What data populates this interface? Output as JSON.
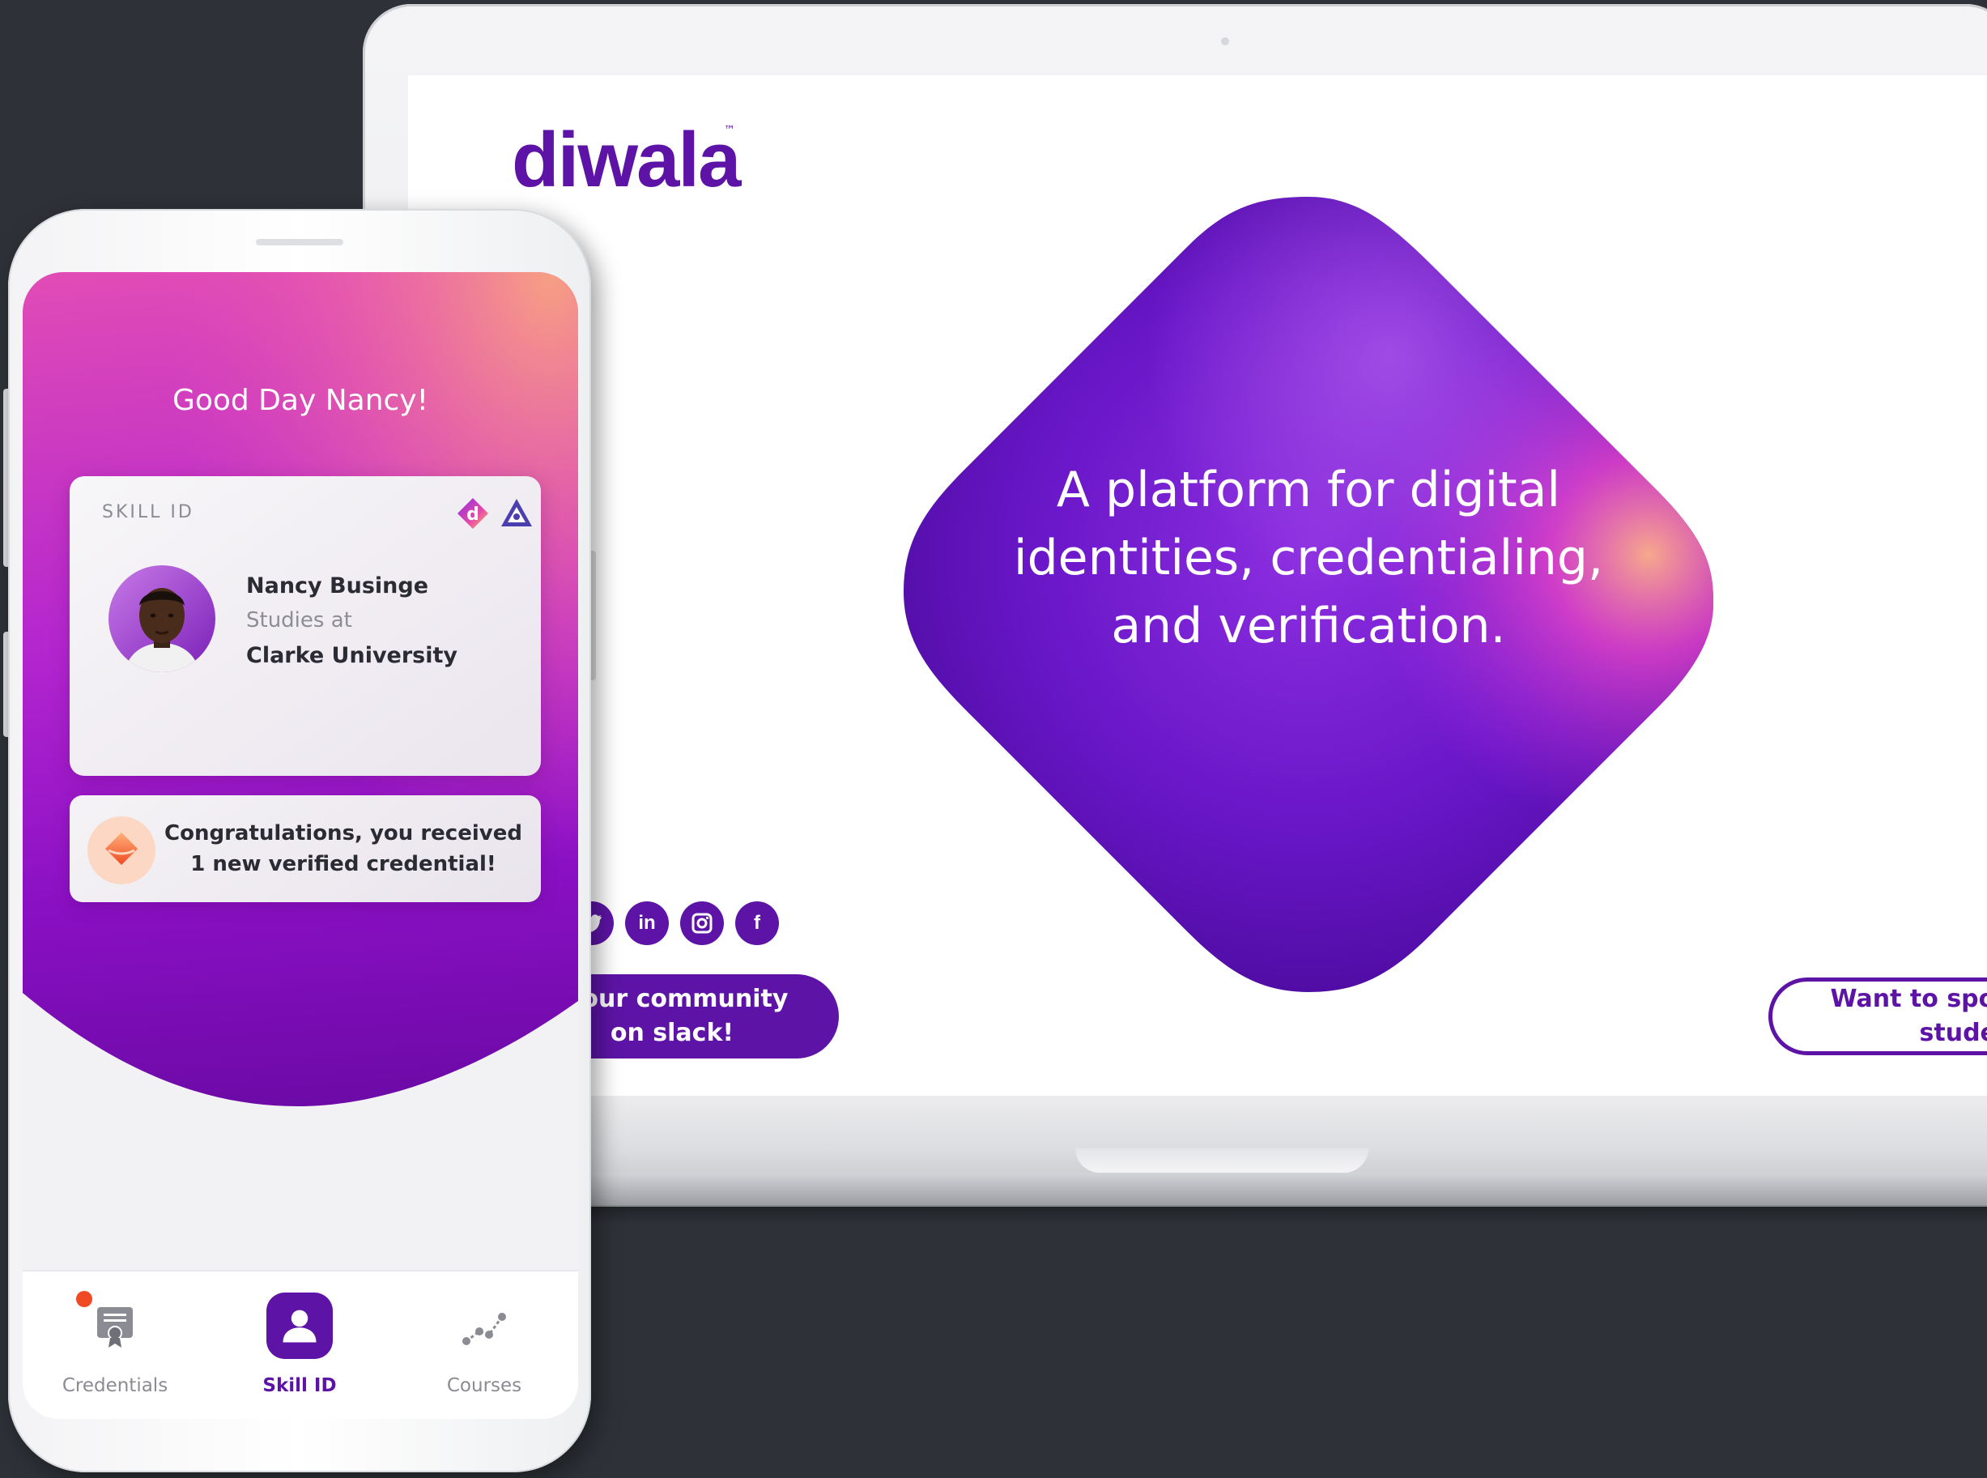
{
  "laptop": {
    "brand": {
      "name": "diwala",
      "tm": "™"
    },
    "hero": {
      "line1": "A platform for digital",
      "line2": "identities, credentialing,",
      "line3": "and verification."
    },
    "social": {
      "twitter_icon": "twitter-icon",
      "linkedin_label": "in",
      "instagram_icon": "instagram-icon",
      "facebook_label": "f"
    },
    "slack_button": {
      "line1": "n our community",
      "line2": "on slack!"
    },
    "sponsor_button": {
      "line1": "Want to spons",
      "line2": "student?"
    }
  },
  "phone": {
    "greeting": "Good Day Nancy!",
    "skill_card": {
      "title": "SKILL ID",
      "name": "Nancy Businge",
      "studies_label": "Studies at",
      "university": "Clarke University"
    },
    "notice": {
      "line1": "Congratulations, you received",
      "line2": "1 new verified credential!"
    },
    "tabs": [
      {
        "label": "Credentials",
        "icon": "certificate-icon",
        "active": false,
        "badge": true
      },
      {
        "label": "Skill ID",
        "icon": "person-icon",
        "active": true,
        "badge": false
      },
      {
        "label": "Courses",
        "icon": "path-icon",
        "active": false,
        "badge": false
      }
    ]
  },
  "colors": {
    "brand_purple": "#5d14a6",
    "header_pink": "#e84aa8",
    "header_peach": "#f59a86",
    "badge_red": "#ef4a23",
    "background": "#2e3238"
  }
}
